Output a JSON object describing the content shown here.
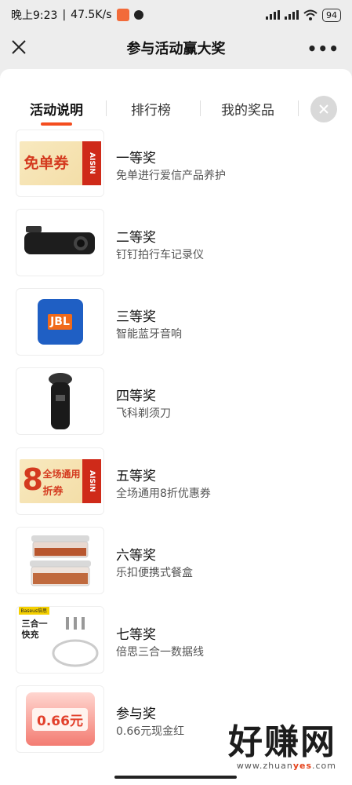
{
  "status_bar": {
    "time": "晚上9:23",
    "net_speed": "47.5K/s",
    "battery": "94"
  },
  "nav": {
    "title": "参与活动赢大奖",
    "more": "•••"
  },
  "tabs": [
    {
      "label": "活动说明",
      "active": true
    },
    {
      "label": "排行榜",
      "active": false
    },
    {
      "label": "我的奖品",
      "active": false
    }
  ],
  "prizes": [
    {
      "title": "一等奖",
      "desc": "免单进行爱信产品养护",
      "thumb_text": "免单券",
      "thumb_brand": "AISIN"
    },
    {
      "title": "二等奖",
      "desc": "钉钉拍行车记录仪"
    },
    {
      "title": "三等奖",
      "desc": "智能蓝牙音响",
      "thumb_text": "JBL"
    },
    {
      "title": "四等奖",
      "desc": "飞科剃须刀"
    },
    {
      "title": "五等奖",
      "desc": "全场通用8折优惠券",
      "thumb_big": "8",
      "thumb_line1": "全场通用",
      "thumb_line2": "折券",
      "thumb_brand": "AISIN"
    },
    {
      "title": "六等奖",
      "desc": "乐扣便携式餐盒"
    },
    {
      "title": "七等奖",
      "desc": "倍思三合一数据线",
      "thumb_line1": "三合一",
      "thumb_line2": "快充",
      "thumb_brand": "Baseus倍思"
    },
    {
      "title": "参与奖",
      "desc": "0.66元现金红",
      "thumb_text": "0.66元"
    }
  ],
  "watermark": {
    "main": "好赚网",
    "sub_pre": "www.zhuan",
    "sub_hl": "yes",
    "sub_post": ".com"
  },
  "colors": {
    "accent": "#f44d1f",
    "coupon_red": "#cf2a19",
    "jbl_blue": "#1f5fc4"
  }
}
